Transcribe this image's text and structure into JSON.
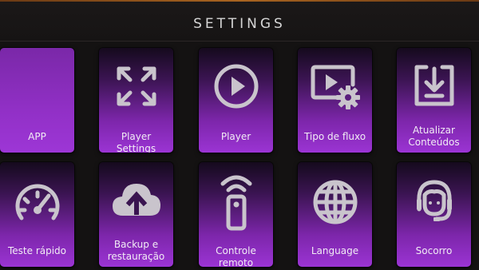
{
  "header": {
    "title": "SETTINGS"
  },
  "tiles": [
    {
      "label": "APP",
      "icon": "app-icon"
    },
    {
      "label": "Player Settings",
      "icon": "expand-arrows-icon"
    },
    {
      "label": "Player",
      "icon": "play-circle-icon"
    },
    {
      "label": "Tipo de fluxo",
      "icon": "video-settings-icon"
    },
    {
      "label": "Atualizar Conteúdos",
      "icon": "download-tray-icon"
    },
    {
      "label": "Teste rápido",
      "icon": "speedometer-icon"
    },
    {
      "label": "Backup e restauração",
      "icon": "cloud-upload-icon"
    },
    {
      "label": "Controle remoto",
      "icon": "remote-control-icon"
    },
    {
      "label": "Language",
      "icon": "globe-icon"
    },
    {
      "label": "Socorro",
      "icon": "support-headset-icon"
    }
  ],
  "colors": {
    "tile_gradient_top": "#150a1d",
    "tile_gradient_bottom": "#9b34d4",
    "icon": "#c9c4cc",
    "background": "#141212"
  }
}
